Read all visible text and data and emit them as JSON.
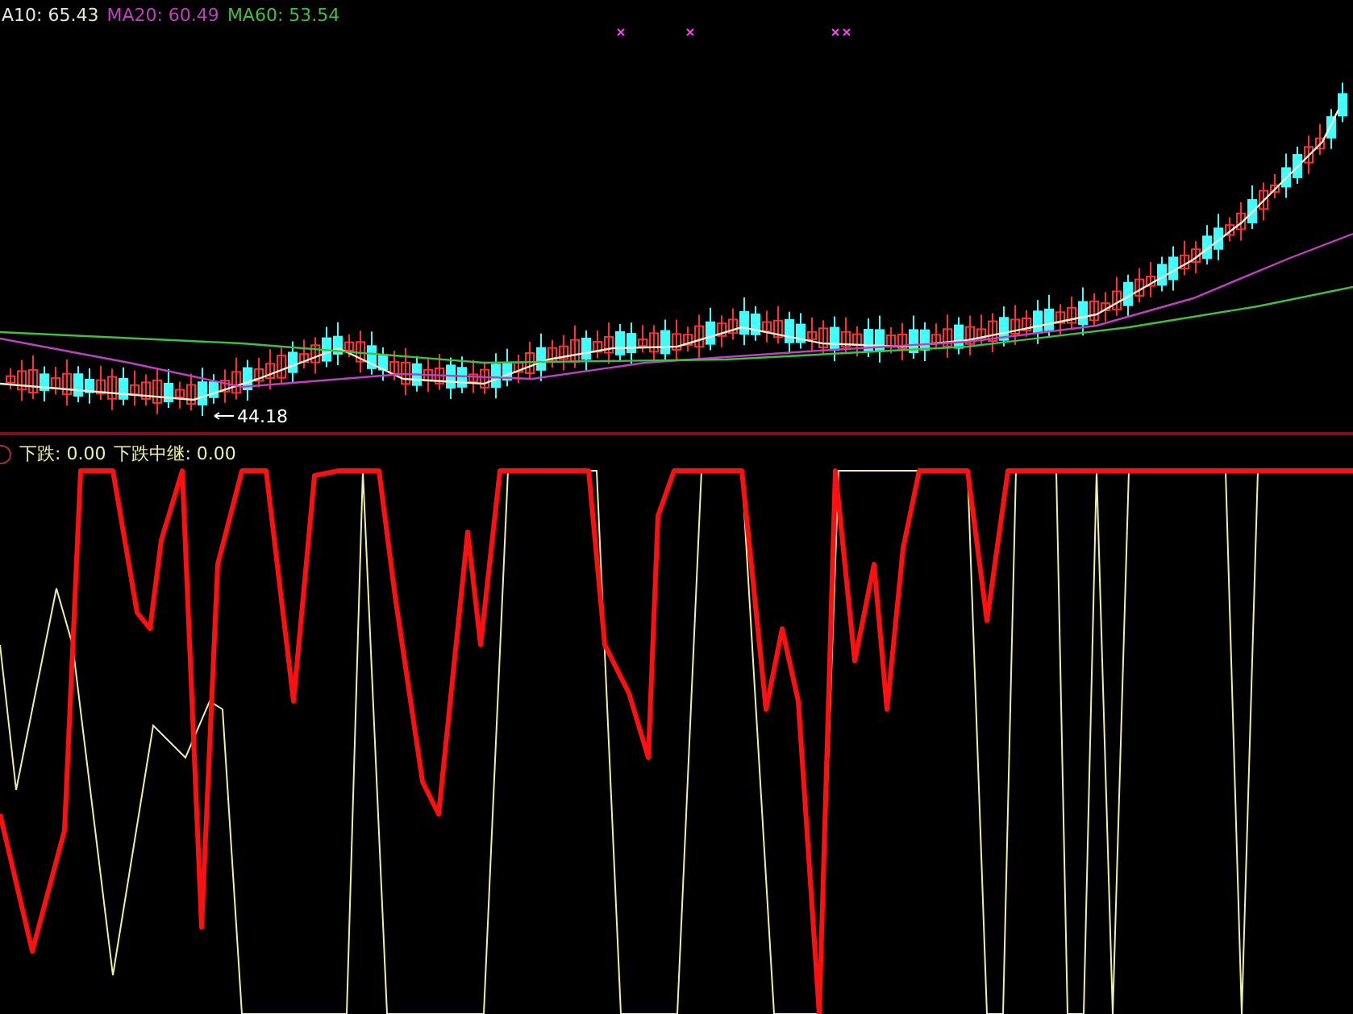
{
  "main_chart": {
    "legend": [
      {
        "label": "A10: 65.43",
        "color": "#e8e8d0"
      },
      {
        "label": "MA20: 60.49",
        "color": "#c040c0"
      },
      {
        "label": "MA60: 53.54",
        "color": "#40c040"
      }
    ],
    "low_label": "44.18"
  },
  "indicator_panel": {
    "legend": [
      {
        "label": "下跌: 0.00",
        "color": "#f0f0a0"
      },
      {
        "label": "下跌中继: 0.00",
        "color": "#f0f0a0"
      }
    ]
  }
}
